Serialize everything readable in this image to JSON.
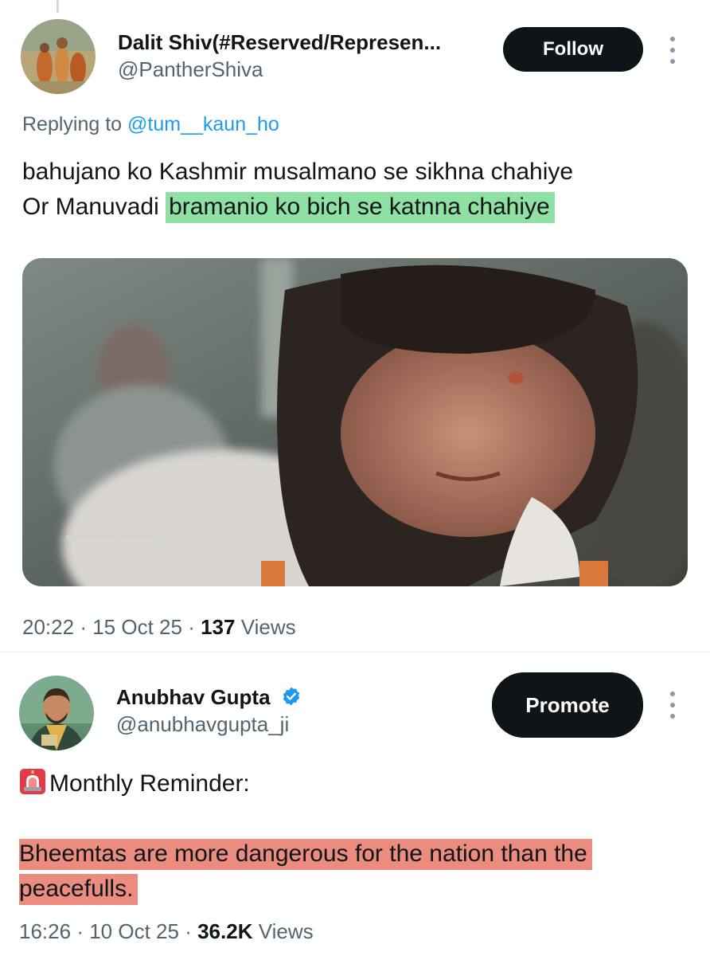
{
  "tweet1": {
    "display_name": "Dalit Shiv(#Reserved/Represen...",
    "handle": "@PantherShiva",
    "follow_label": "Follow",
    "replying_prefix": "Replying to",
    "replying_handle": "@tum__kaun_ho",
    "text_line1": "bahujano ko Kashmir musalmano se sikhna chahiye",
    "text_line2_plain": "Or Manuvadi",
    "text_line2_highlight": "bramanio ko bich se katnna chahiye",
    "media_caption": "",
    "time": "20:22",
    "date": "15 Oct 25",
    "views_count": "137",
    "views_label": "Views",
    "separator": "·",
    "highlight_color": "#8fe0a3"
  },
  "tweet2": {
    "display_name": "Anubhav Gupta",
    "handle": "@anubhavgupta_ji",
    "verified": true,
    "promote_label": "Promote",
    "emoji_icon": "rotating-light-icon",
    "text_line1": "Monthly Reminder:",
    "highlight_line1": "Bheemtas are more dangerous for the nation than the",
    "highlight_line2": "peacefulls.",
    "time": "16:26",
    "date": "10 Oct 25",
    "views_count": "36.2K",
    "views_label": "Views",
    "separator": "·",
    "highlight_color": "#ec8c7f"
  },
  "colors": {
    "text": "#0f1419",
    "secondary": "#536471",
    "link": "#1d9bf0",
    "button": "#0f1419"
  }
}
